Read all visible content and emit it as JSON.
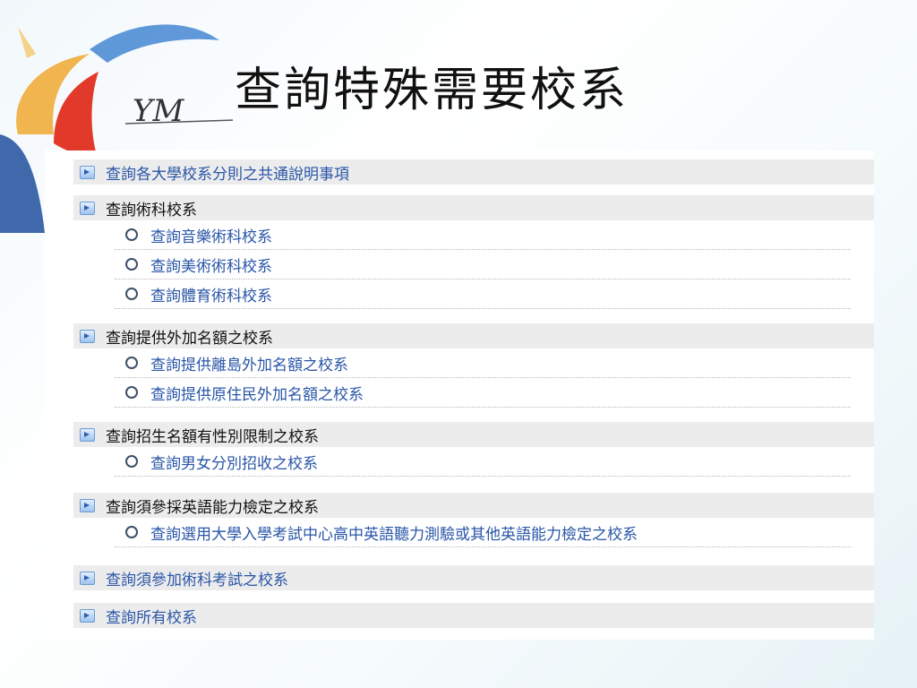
{
  "slide": {
    "logo_text": "YM",
    "title": "查詢特殊需要校系"
  },
  "sections": [
    {
      "label": "查詢各大學校系分則之共通說明事項",
      "style": "link",
      "items": []
    },
    {
      "label": "查詢術科校系",
      "style": "plain",
      "items": [
        "查詢音樂術科校系",
        "查詢美術術科校系",
        "查詢體育術科校系"
      ]
    },
    {
      "label": "查詢提供外加名額之校系",
      "style": "plain",
      "items": [
        "查詢提供離島外加名額之校系",
        "查詢提供原住民外加名額之校系"
      ]
    },
    {
      "label": "查詢招生名額有性別限制之校系",
      "style": "plain",
      "items": [
        "查詢男女分別招收之校系"
      ]
    },
    {
      "label": "查詢須參採英語能力檢定之校系",
      "style": "plain",
      "items": [
        "查詢選用大學入學考試中心高中英語聽力測驗或其他英語能力檢定之校系"
      ]
    },
    {
      "label": "查詢須參加術科考試之校系",
      "style": "link",
      "items": []
    },
    {
      "label": "查詢所有校系",
      "style": "link",
      "items": []
    }
  ],
  "icons": {
    "section": "expand-arrow-icon",
    "item": "radio-ring-icon"
  },
  "colors": {
    "link": "#2a56a8",
    "header_bg": "#ececec",
    "title": "#111111"
  }
}
